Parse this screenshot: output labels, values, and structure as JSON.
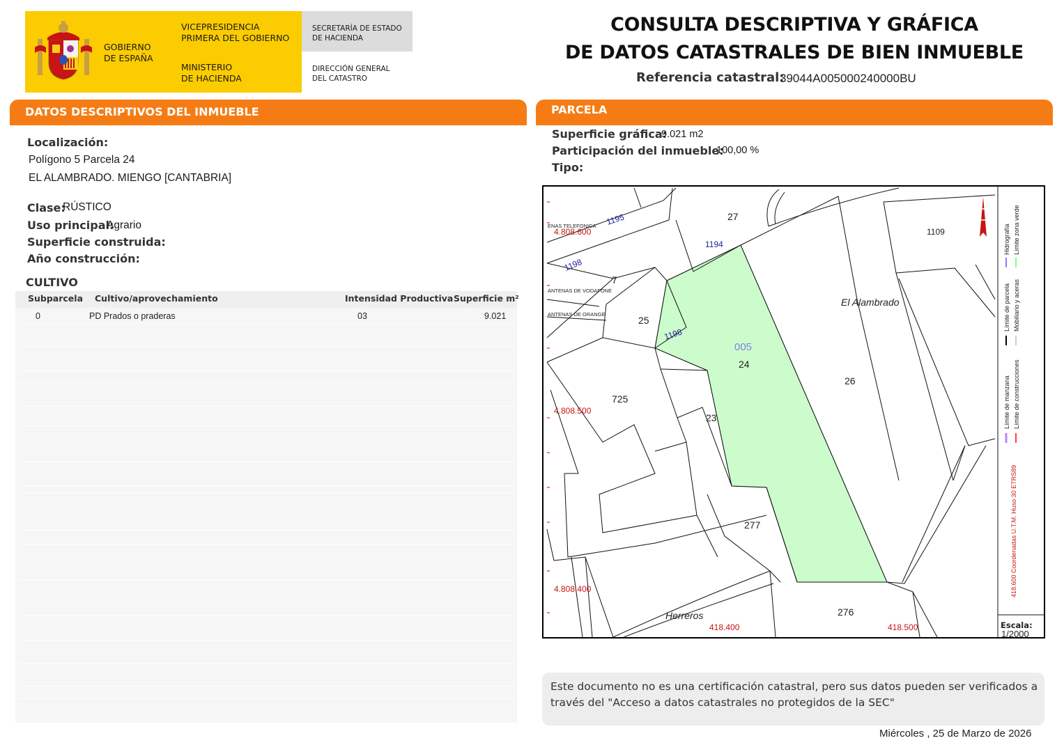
{
  "header": {
    "gov_name": "GOBIERNO\nDE ESPAÑA",
    "vice": "VICEPRESIDENCIA\nPRIMERA DEL GOBIERNO",
    "ministry": "MINISTERIO\nDE HACIENDA",
    "secretaria": "SECRETARÍA DE ESTADO\nDE HACIENDA",
    "direccion": "DIRECCIÓN GENERAL\nDEL CATASTRO"
  },
  "title": {
    "line1": "CONSULTA DESCRIPTIVA Y GRÁFICA",
    "line2": "DE DATOS CATASTRALES DE BIEN INMUEBLE",
    "ref_label": "Referencia catastral:",
    "ref_value": "39044A005000240000BU"
  },
  "left_section": {
    "header": "DATOS DESCRIPTIVOS DEL INMUEBLE",
    "localizacion_label": "Localización:",
    "localizacion_line1": "Polígono 5 Parcela 24",
    "localizacion_line2": "EL ALAMBRADO. MIENGO [CANTABRIA]",
    "clase_label": "Clase:",
    "clase_value": "RÚSTICO",
    "uso_label": "Uso principal:",
    "uso_value": "Agrario",
    "superficie_label": "Superficie construida:",
    "anio_label": "Año construcción:",
    "cultivo_title": "CULTIVO",
    "table": {
      "columns": [
        "Subparcela",
        "Cultivo/aprovechamiento",
        "Intensidad Productiva",
        "Superficie m²"
      ],
      "rows": [
        {
          "subparcela": "0",
          "cultivo": "PD Prados o praderas",
          "intensidad": "03",
          "superficie": "9.021"
        }
      ]
    }
  },
  "right_section": {
    "header": "PARCELA",
    "sup_grafica_label": "Superficie gráfica:",
    "sup_grafica_value": "9.021 m2",
    "participacion_label": "Participación del inmueble:",
    "participacion_value": "100,00 %",
    "tipo_label": "Tipo:"
  },
  "map": {
    "labels": {
      "p27": "27",
      "p1109": "1109",
      "p1195": "1195",
      "p1194": "1194",
      "p1198a": "1198",
      "p7": "7",
      "p25": "25",
      "p1198b": "1198",
      "p005": "005",
      "p24": "24",
      "p26": "26",
      "p725": "725",
      "p23": "23",
      "p277": "277",
      "p276": "276",
      "alambrado": "El   Alambrado",
      "herreros": "Herreros",
      "antenas_tel": "ENAS TELEFONICA",
      "antenas_voda": "ANTENAS DE VODAFONE",
      "antenas_orange": "ANTENAS DE ORANGE"
    },
    "coords": {
      "n600": "4.808.600",
      "n500": "4.808.500",
      "n400": "4.808.400",
      "e400": "418.400",
      "e500": "418.500"
    },
    "legend": {
      "hidrografia": "Hidrografía",
      "zona_verde": "Límite zona verde",
      "parcela": "Límite de parcela",
      "mobiliario": "Mobiliario y aceras",
      "manzana": "Límite de manzana",
      "construcciones": "Límite de construcciones",
      "coords_note": "418.600 Coordenadas U.T.M. Huso 30 ETRS89"
    },
    "scale_label": "Escala:",
    "scale_value": "1/2000",
    "highlight_color": "#ccfccc"
  },
  "footer": {
    "note": "Este documento no es una certificación catastral, pero sus datos pueden ser verificados a través del \"Acceso a datos catastrales no protegidos de la SEC\"",
    "date": "Miércoles , 25 de Marzo de 2026"
  }
}
